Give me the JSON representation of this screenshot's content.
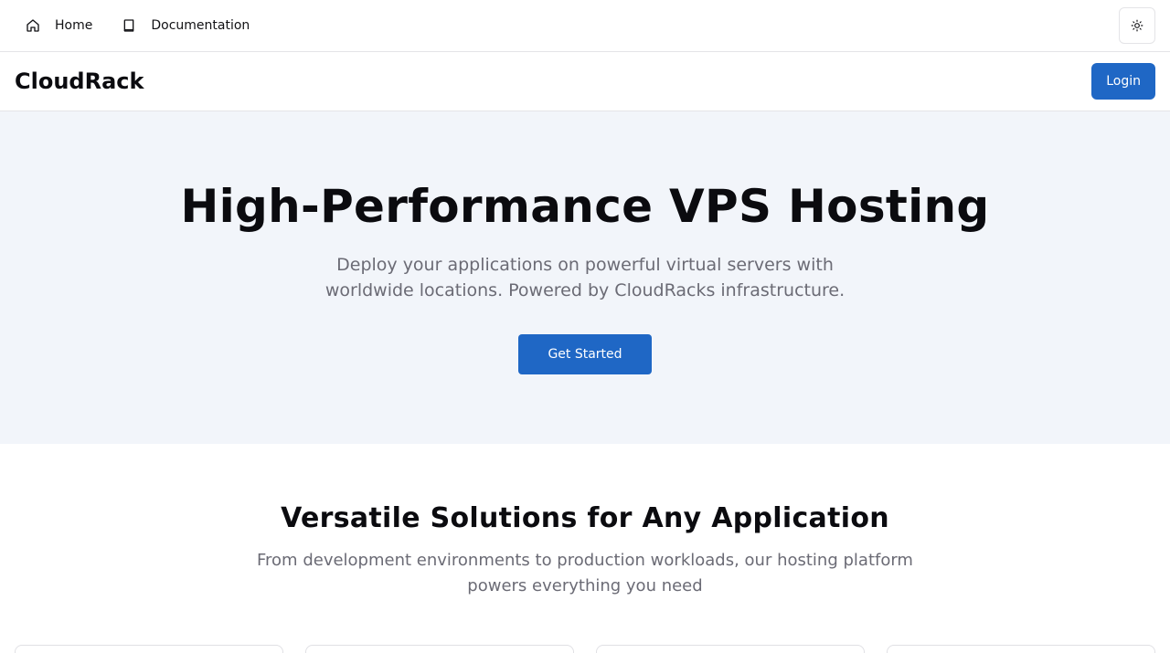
{
  "topnav": {
    "links": [
      {
        "label": "Home",
        "icon": "home-icon"
      },
      {
        "label": "Documentation",
        "icon": "book-icon"
      }
    ],
    "theme_toggle_icon": "sun-icon"
  },
  "header": {
    "brand": "CloudRack",
    "login_label": "Login"
  },
  "hero": {
    "title": "High-Performance VPS Hosting",
    "subtitle": "Deploy your applications on powerful virtual servers with worldwide locations. Powered by CloudRacks infrastructure.",
    "cta_label": "Get Started"
  },
  "solutions": {
    "title": "Versatile Solutions for Any Application",
    "subtitle": "From development environments to production workloads, our hosting platform powers everything you need"
  },
  "colors": {
    "primary": "#1f67c5",
    "hero_background": "#f2f5fa",
    "muted_text": "#6b6b75",
    "border": "#e4e4e7"
  }
}
